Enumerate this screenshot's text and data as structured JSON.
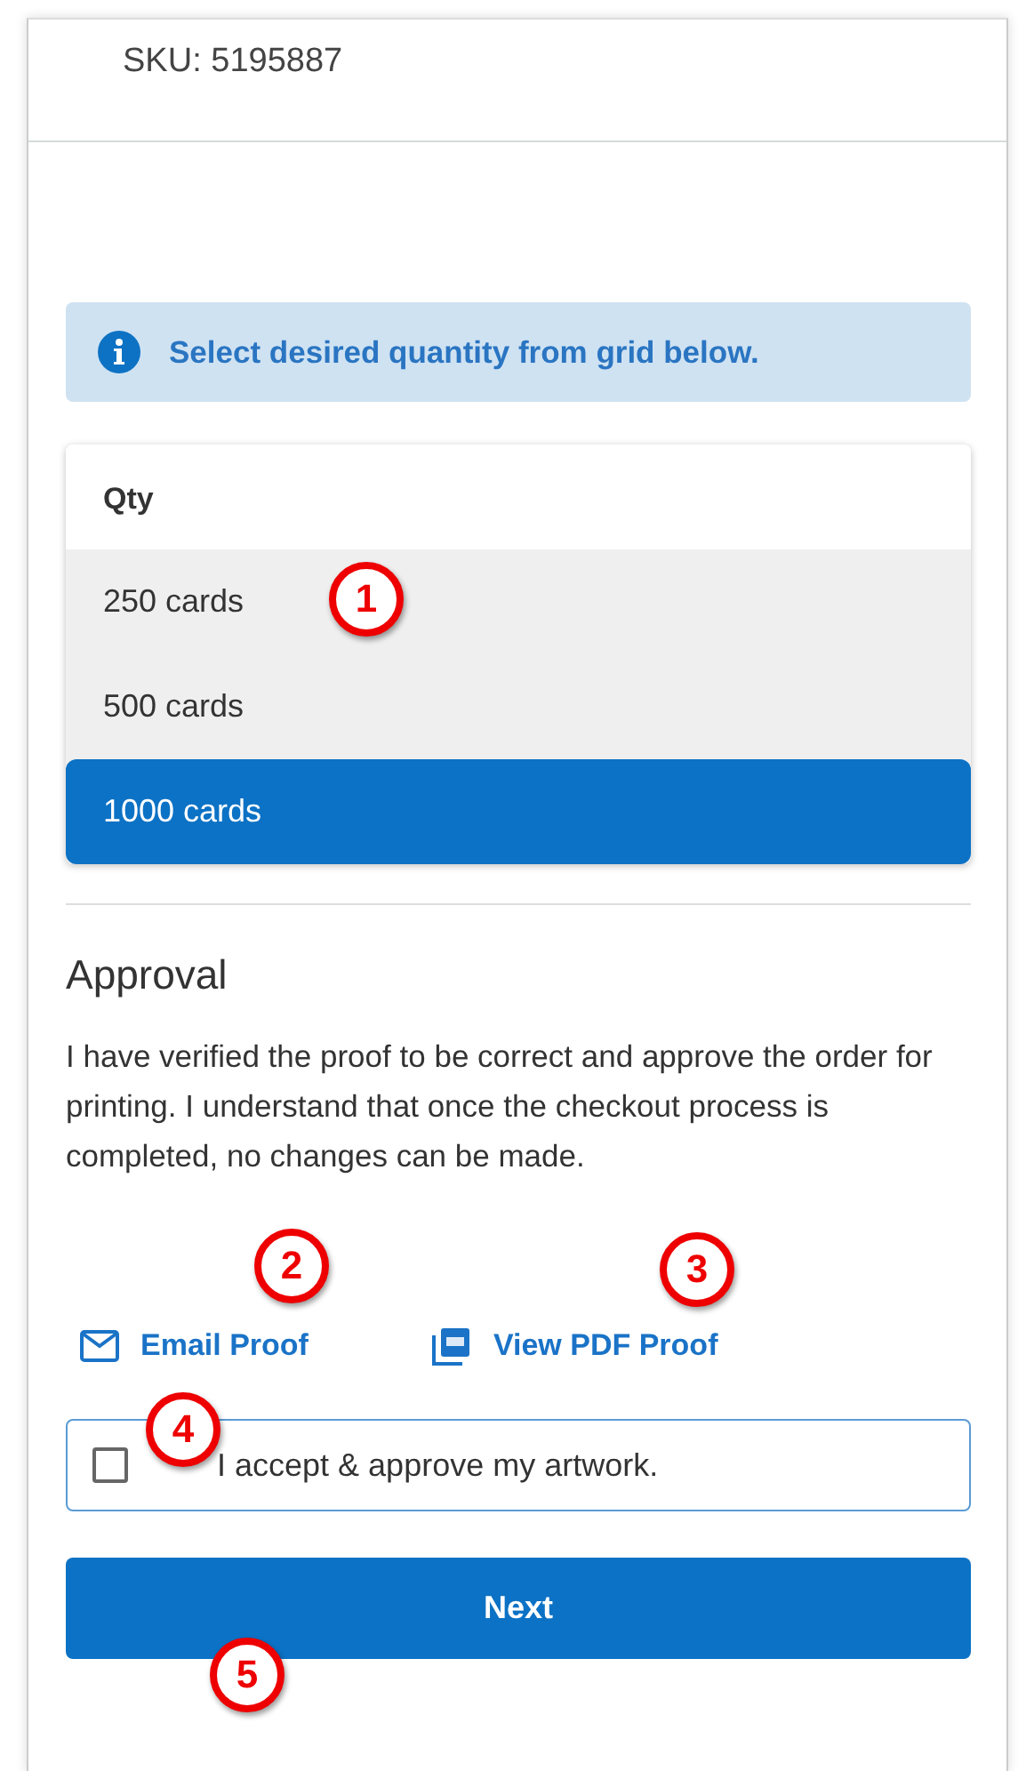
{
  "sku": "SKU: 5195887",
  "info_banner": {
    "text": "Select desired quantity from grid below."
  },
  "quantity_grid": {
    "header": "Qty",
    "rows": [
      {
        "label": "250 cards",
        "selected": false
      },
      {
        "label": "500 cards",
        "selected": false
      },
      {
        "label": "1000 cards",
        "selected": true
      }
    ]
  },
  "approval": {
    "heading": "Approval",
    "text": "I have verified the proof to be correct and approve the order for printing. I understand that once the checkout process is completed, no changes can be made.",
    "links": [
      {
        "kind": "email",
        "label": "Email Proof"
      },
      {
        "kind": "pdf",
        "label": "View PDF Proof"
      }
    ],
    "checkbox": {
      "label": "I accept & approve my artwork.",
      "checked": false
    }
  },
  "next_button": "Next",
  "callouts": [
    {
      "label": "1"
    },
    {
      "label": "2"
    },
    {
      "label": "3"
    },
    {
      "label": "4"
    },
    {
      "label": "5"
    }
  ]
}
